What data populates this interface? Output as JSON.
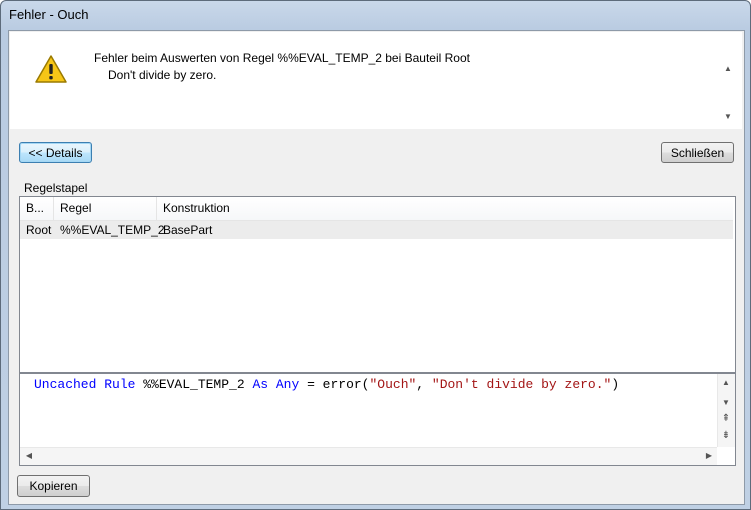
{
  "window": {
    "title": "Fehler - Ouch"
  },
  "message": {
    "line1": "Fehler beim Auswerten von Regel %%EVAL_TEMP_2 bei Bauteil Root",
    "line2": "Don't divide by zero."
  },
  "buttons": {
    "details": "<< Details",
    "close": "Schließen",
    "copy": "Kopieren"
  },
  "group": {
    "label": "Regelstapel"
  },
  "table": {
    "columns": [
      "B...",
      "Regel",
      "Konstruktion"
    ],
    "rows": [
      [
        "Root",
        "%%EVAL_TEMP_2",
        "BasePart"
      ]
    ]
  },
  "code": {
    "tokens": [
      {
        "t": "Uncached Rule",
        "k": "kw"
      },
      {
        "t": " %%EVAL_TEMP_2 ",
        "k": "plain"
      },
      {
        "t": "As Any",
        "k": "kw"
      },
      {
        "t": " = error(",
        "k": "plain"
      },
      {
        "t": "\"Ouch\"",
        "k": "str"
      },
      {
        "t": ", ",
        "k": "plain"
      },
      {
        "t": "\"Don't divide by zero.\"",
        "k": "str"
      },
      {
        "t": ")",
        "k": "plain"
      }
    ]
  },
  "icons": {
    "warning": "warning-icon"
  },
  "colors": {
    "keyword": "#0000ff",
    "string": "#a31515",
    "selected_row": "#ececec"
  }
}
